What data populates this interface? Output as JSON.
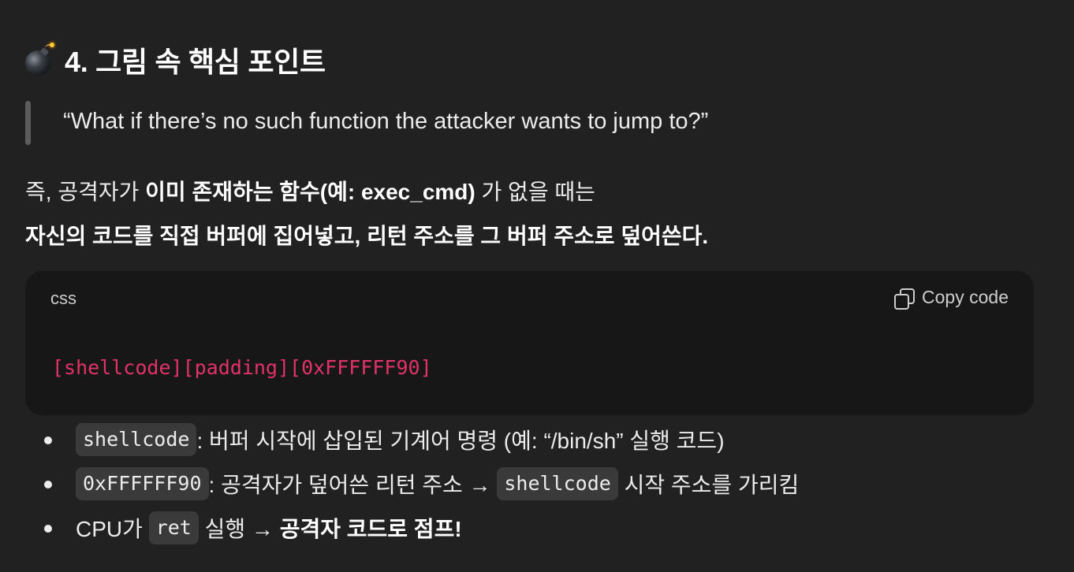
{
  "heading": {
    "icon": "bomb-icon",
    "text": "4. 그림 속 핵심 포인트"
  },
  "quote": "“What if there’s no such function the attacker wants to jump to?”",
  "paragraph1": {
    "part1": "즉, 공격자가 ",
    "bold": "이미 존재하는 함수(예: exec_cmd)",
    "part2": " 가 없을 때는"
  },
  "paragraph2": "자신의 코드를 직접 버퍼에 집어넣고, 리턴 주소를 그 버퍼 주소로 덮어쓴다.",
  "code_block": {
    "language": "css",
    "copy_label": "Copy code",
    "code": "[shellcode][padding][0xFFFFFF90]",
    "code_color": "#e3326a"
  },
  "bullets": [
    {
      "code": "shellcode",
      "text": ": 버퍼 시작에 삽입된 기계어 명령 (예: “/bin/sh” 실행 코드)"
    },
    {
      "code": "0xFFFFFF90",
      "text": ": 공격자가 덮어쓴 리턴 주소 → ",
      "code2": "shellcode",
      "text2": " 시작 주소를 가리킴"
    },
    {
      "text": "CPU가 ",
      "code": "ret",
      "text2": " 실행 → ",
      "bold": "공격자 코드로 점프!"
    }
  ],
  "colors": {
    "background": "#212121",
    "code_background": "#171717",
    "inline_code_background": "#3a3a3a",
    "text": "#ececec"
  }
}
